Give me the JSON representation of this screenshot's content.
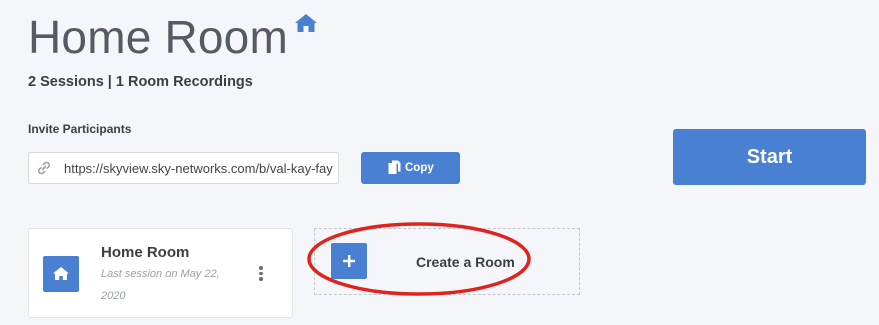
{
  "page": {
    "title": "Home Room",
    "subtitle": "2 Sessions | 1 Room Recordings"
  },
  "invite": {
    "label": "Invite Participants",
    "url": "https://skyview.sky-networks.com/b/val-kay-fay",
    "copy_label": "Copy"
  },
  "start_label": "Start",
  "rooms": [
    {
      "name": "Home Room",
      "last_session": "Last session on May 22, 2020"
    }
  ],
  "create_room_label": "Create a Room",
  "colors": {
    "accent": "#4a80d2",
    "background": "#f5f6fa",
    "annotation": "#e0241b"
  },
  "icons": {
    "title": "home-icon",
    "url": "link-icon",
    "copy": "copy-icon",
    "room": "home-icon",
    "menu": "kebab-menu-icon",
    "create": "plus-icon"
  }
}
